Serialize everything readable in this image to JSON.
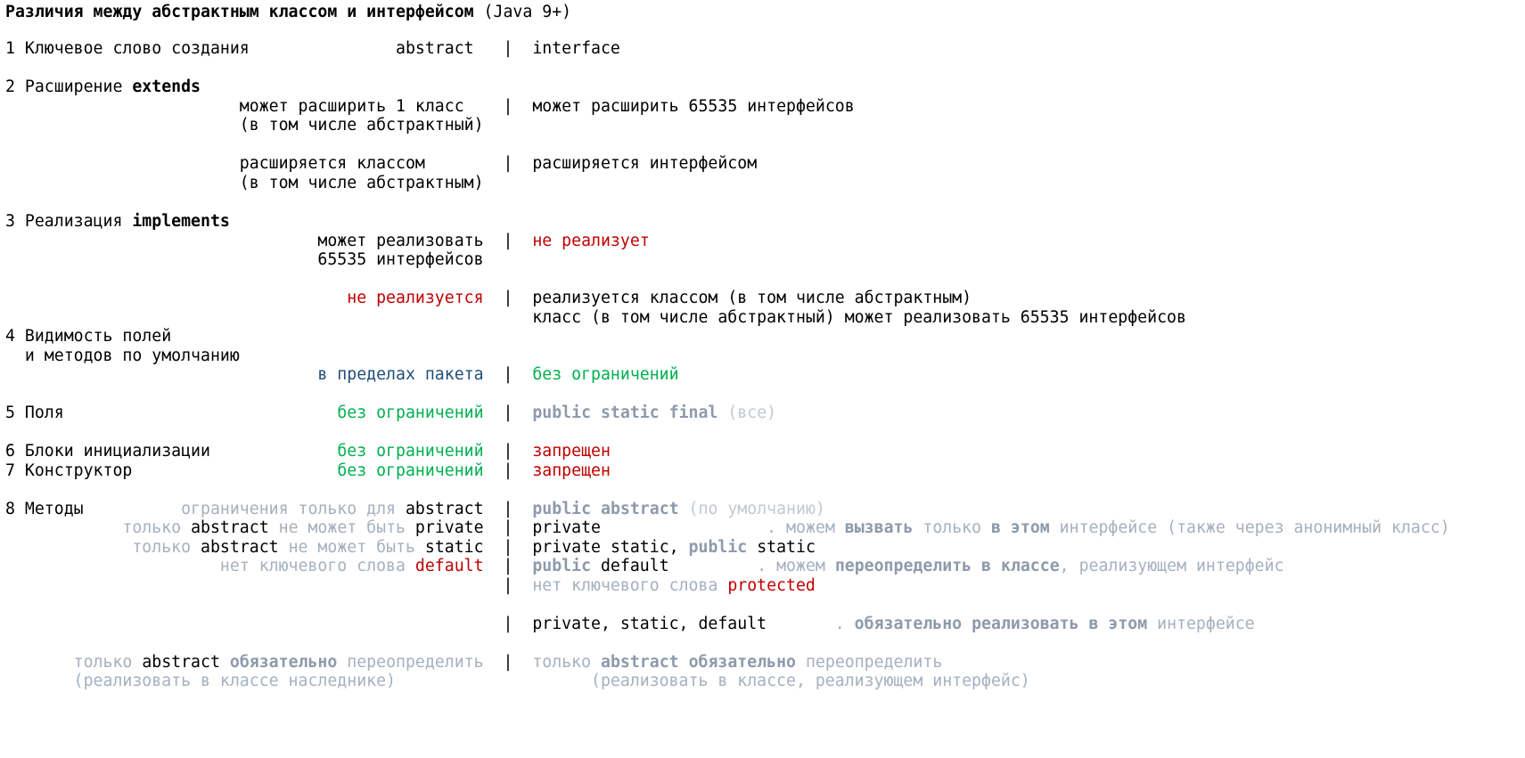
{
  "title": {
    "main": "Различия между абстрактным классом и интерфейсом",
    "suffix": " (Java 9+)"
  },
  "sections": {
    "creation": {
      "heading": "1 Ключевое слово создания",
      "abstract": "abstract",
      "interface": "interface"
    },
    "extends": {
      "heading_prefix": "2 Расширение ",
      "heading_keyword": "extends",
      "abstract_line1": "может расширить 1 класс",
      "abstract_line2": "(в том числе абстрактный)",
      "interface_line1": "может расширить 65535 интерфейсов",
      "abstract_line3": "расширяется классом",
      "abstract_line4": "(в том числе абстрактным)",
      "interface_line2": "расширяется интерфейсом"
    },
    "implements": {
      "heading_prefix": "3 Реализация ",
      "heading_keyword": "implements",
      "abstract_line1": "может реализовать",
      "abstract_line2": "65535 интерфейсов",
      "interface_line1": "не реализует",
      "abstract_line3": "не реализуется",
      "interface_line2": "реализуется классом (в том числе абстрактным)",
      "interface_line3": "класс (в том числе абстрактный) может реализовать 65535 интерфейсов"
    },
    "visibility": {
      "heading_line1": "4 Видимость полей",
      "heading_line2": "  и методов по умолчанию",
      "abstract": "в пределах пакета",
      "interface": "без ограничений"
    },
    "fields": {
      "heading": "5 Поля",
      "abstract": "без ограничений",
      "interface_kw": "public static final",
      "interface_note": " (все)"
    },
    "init_blocks": {
      "heading": "6 Блоки инициализации",
      "abstract": "без ограничений",
      "interface": "запрещен"
    },
    "constructor": {
      "heading": "7 Конструктор",
      "abstract": "без ограничений",
      "interface": "запрещен"
    },
    "methods": {
      "heading": "8 Методы",
      "row1_abstract_grey": "ограничения только для ",
      "row1_abstract_kw": "abstract",
      "row1_interface_kw": "public abstract",
      "row1_interface_note": " (по умолчанию)",
      "row2_abstract_grey1": "только ",
      "row2_abstract_kw1": "abstract",
      "row2_abstract_grey2": " не может быть ",
      "row2_abstract_kw2": "private",
      "row2_interface": "private",
      "row2_note_1": ". можем ",
      "row2_note_2": "вызвать",
      "row2_note_3": " только ",
      "row2_note_4": "в этом",
      "row2_note_5": " интерфейсе (также через анонимный класс)",
      "row3_abstract_grey1": "только ",
      "row3_abstract_kw1": "abstract",
      "row3_abstract_grey2": " не может быть ",
      "row3_abstract_kw2": "static",
      "row3_interface_1": "private static, ",
      "row3_interface_2": "public",
      "row3_interface_3": " static",
      "row4_abstract_grey": "нет ключевого слова ",
      "row4_abstract_kw": "default",
      "row4_interface_1": "public",
      "row4_interface_2": " default",
      "row4_note_1": ". можем ",
      "row4_note_2": "переопределить в классе",
      "row4_note_3": ", реализующем интерфейс",
      "row5_interface_grey": "нет ключевого слова ",
      "row5_interface_kw": "protected",
      "row6_interface": "private, static, default",
      "row6_note_1": ". ",
      "row6_note_2": "обязательно реализовать в этом",
      "row6_note_3": " интерфейсе",
      "row7_abstract_1": "только ",
      "row7_abstract_2": "abstract",
      "row7_abstract_3": " ",
      "row7_abstract_4": "обязательно",
      "row7_abstract_5": " переопределить",
      "row7_abstract_6": "(реализовать в классе наследнике)",
      "row7_interface_1": "только ",
      "row7_interface_2": "abstract",
      "row7_interface_3": " ",
      "row7_interface_4": "обязательно",
      "row7_interface_5": " переопределить",
      "row7_interface_6": "(реализовать в классе, реализующем интерфейс)"
    }
  },
  "divider": "|"
}
